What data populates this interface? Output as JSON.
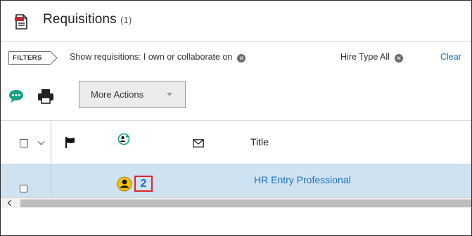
{
  "header": {
    "title": "Requisitions",
    "count": "(1)"
  },
  "filters": {
    "tag": "FILTERS",
    "chips": [
      {
        "label": "Show requisitions: I own or collaborate on"
      },
      {
        "label": "Hire Type All"
      }
    ],
    "clear_label": "Clear"
  },
  "toolbar": {
    "more_actions_label": "More Actions"
  },
  "table": {
    "columns": {
      "title": "Title"
    },
    "rows": [
      {
        "count": "2",
        "title": "HR Entry Professional"
      }
    ]
  },
  "colors": {
    "link": "#1a6fc2",
    "row_selected": "#cfe2f1",
    "highlight_box": "#e0262b",
    "chat_icon": "#16a085",
    "title_icon": "#c0282d",
    "user_icon": "#f2c200"
  },
  "icons": {
    "title": "requisition-document-icon",
    "chat": "chat-bubble-icon",
    "print": "printer-icon",
    "flag": "flag-icon",
    "assign": "assign-user-icon",
    "mail": "envelope-icon",
    "user": "user-icon"
  }
}
